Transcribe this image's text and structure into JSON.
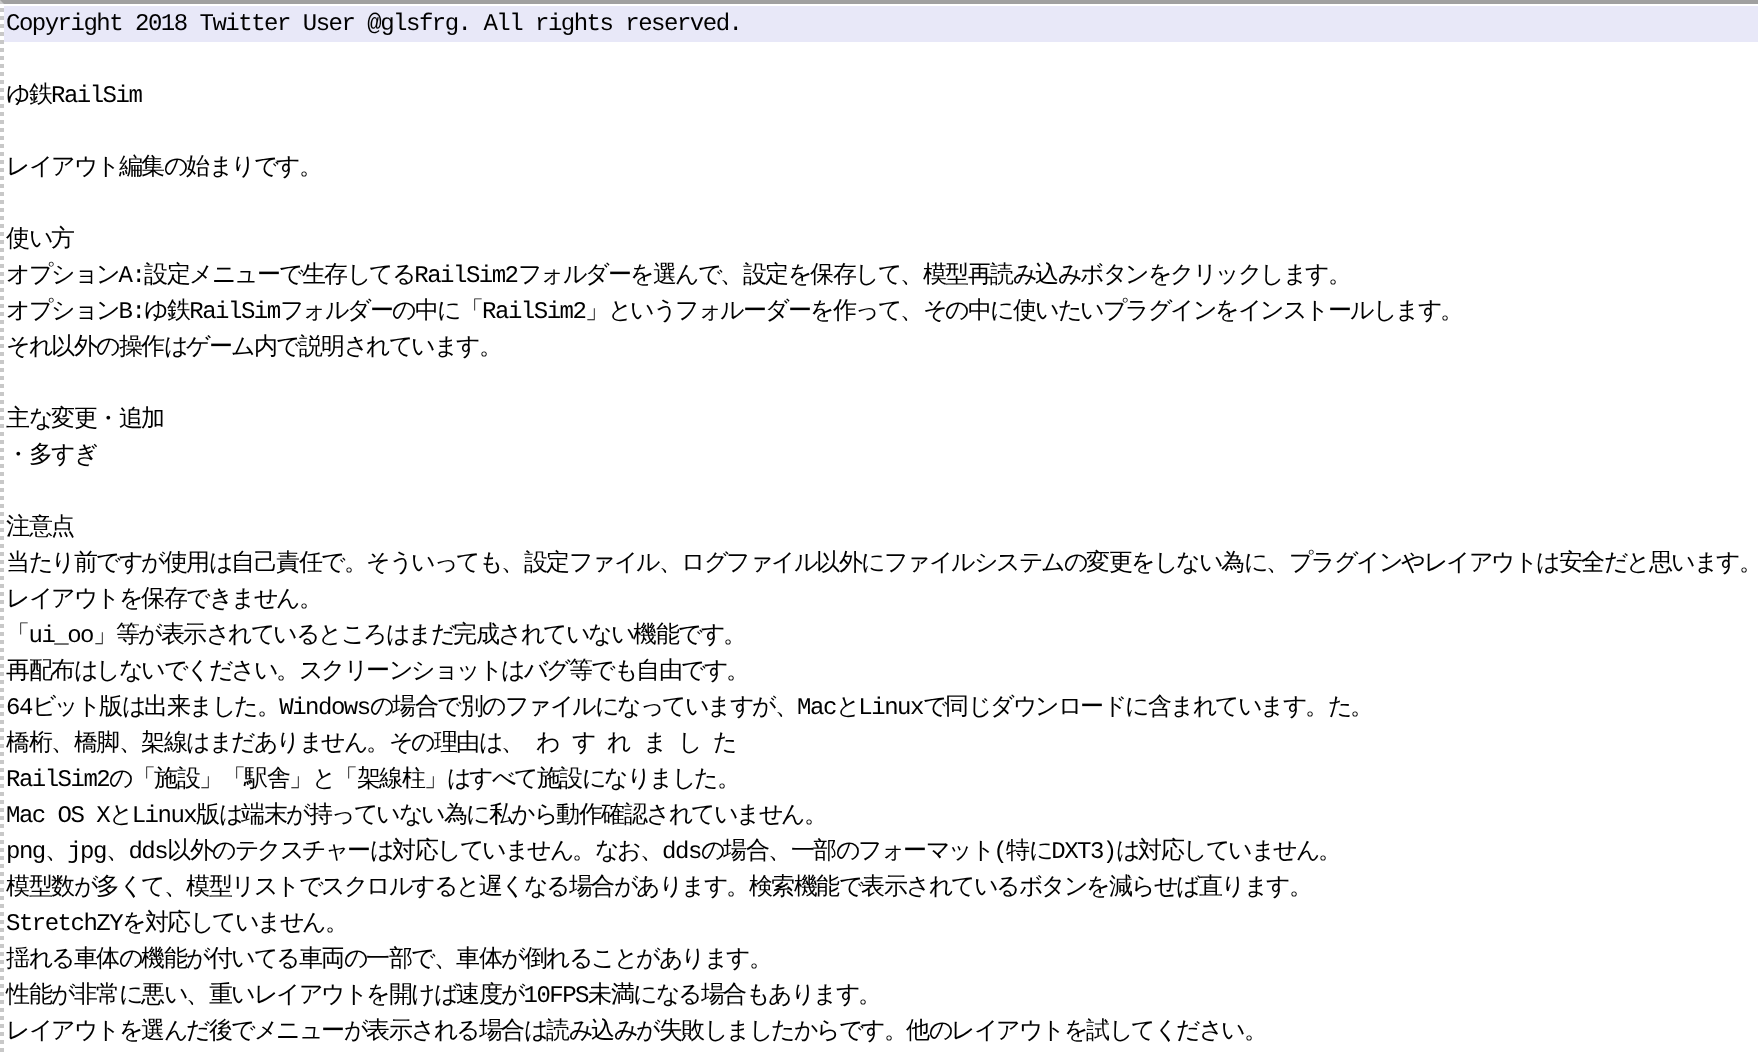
{
  "editor": {
    "paragraphs": [
      [
        {
          "text": "Copyright 2018 Twitter User @glsfrg. All rights reserved.",
          "current": true
        }
      ],
      [
        {
          "text": "ゆ鉄RailSim",
          "current": false
        }
      ],
      [
        {
          "text": "レイアウト編集の始まりです。",
          "current": false
        }
      ],
      [
        {
          "text": "使い方",
          "current": false
        },
        {
          "text": "オプションA:設定メニューで生存してるRailSim2フォルダーを選んで、設定を保存して、模型再読み込みボタンをクリックします。",
          "current": false
        },
        {
          "text": "オプションB:ゆ鉄RailSimフォルダーの中に「RailSim2」というフォルーダーを作って、その中に使いたいプラグインをインストールします。",
          "current": false
        },
        {
          "text": "それ以外の操作はゲーム内で説明されています。",
          "current": false
        }
      ],
      [
        {
          "text": "主な変更・追加",
          "current": false
        },
        {
          "text": "・多すぎ",
          "current": false
        }
      ],
      [
        {
          "text": "注意点",
          "current": false
        },
        {
          "text": "当たり前ですが使用は自己責任で。そういっても、設定ファイル、ログファイル以外にファイルシステムの変更をしない為に、プラグインやレイアウトは安全だと思います。",
          "current": false
        },
        {
          "text": "レイアウトを保存できません。",
          "current": false
        },
        {
          "text": "「ui_oo」等が表示されているところはまだ完成されていない機能です。",
          "current": false
        },
        {
          "text": "再配布はしないでください。スクリーンショットはバグ等でも自由です。",
          "current": false
        },
        {
          "text": "64ビット版は出来ました。Windowsの場合で別のファイルになっていますが、MacとLinuxで同じダウンロードに含まれています。た。",
          "current": false
        },
        {
          "text": "橋桁、橋脚、架線はまだありません。その理由は、 わ す れ ま し た",
          "current": false
        },
        {
          "text": "RailSim2の「施設」「駅舎」と「架線柱」はすべて施設になりました。",
          "current": false
        },
        {
          "text": "Mac OS XとLinux版は端末が持っていない為に私から動作確認されていません。",
          "current": false
        },
        {
          "text": "png、jpg、dds以外のテクスチャーは対応していません。なお、ddsの場合、一部のフォーマット(特にDXT3)は対応していません。",
          "current": false
        },
        {
          "text": "模型数が多くて、模型リストでスクロルすると遅くなる場合があります。検索機能で表示されているボタンを減らせば直ります。",
          "current": false
        },
        {
          "text": "StretchZYを対応していません。",
          "current": false
        },
        {
          "text": "揺れる車体の機能が付いてる車両の一部で、車体が倒れることがあります。",
          "current": false
        },
        {
          "text": "性能が非常に悪い、重いレイアウトを開けば速度が10FPS未満になる場合もあります。",
          "current": false
        },
        {
          "text": "レイアウトを選んだ後でメニューが表示される場合は読み込みが失敗しましたからです。他のレイアウトを試してください。",
          "current": false
        }
      ]
    ]
  }
}
